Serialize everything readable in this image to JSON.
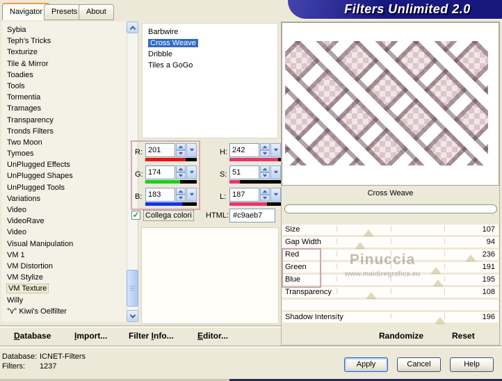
{
  "window": {
    "title": "Filters Unlimited 2.0"
  },
  "tabs": [
    {
      "label": "Navigator",
      "active": true
    },
    {
      "label": "Presets",
      "active": false
    },
    {
      "label": "About",
      "active": false
    }
  ],
  "category_list": {
    "selected": "VM Texture",
    "items": [
      "Sybia",
      "Teph's Tricks",
      "Texturize",
      "Tile & Mirror",
      "Toadies",
      "Tools",
      "Tormentia",
      "Tramages",
      "Transparency",
      "Tronds Filters",
      "Two Moon",
      "Tymoes",
      "UnPlugged Effects",
      "UnPlugged Shapes",
      "UnPlugged Tools",
      "Variations",
      "Video",
      "VideoRave",
      "Video",
      "Visual Manipulation",
      "VM 1",
      "VM Distortion",
      "VM Stylize",
      "VM Texture",
      "Willy",
      "°v° Kiwi's Oelfilter"
    ]
  },
  "filter_list": {
    "selected": "Cross Weave",
    "items": [
      "Barbwire",
      "Cross Weave",
      "Dribble",
      "Tiles a GoGo"
    ]
  },
  "color_controls": {
    "rgb": [
      {
        "label": "R:",
        "value": "201",
        "pct": 79,
        "bar_color": "#ee1111"
      },
      {
        "label": "G:",
        "value": "174",
        "pct": 68,
        "bar_color": "#1ad01a"
      },
      {
        "label": "B:",
        "value": "183",
        "pct": 72,
        "bar_color": "#1133ee"
      }
    ],
    "hsl": [
      {
        "label": "H:",
        "value": "242",
        "pct": 95,
        "bar_color": "#e8356d"
      },
      {
        "label": "S:",
        "value": "51",
        "pct": 20,
        "bar_color": "#e8356d"
      },
      {
        "label": "L:",
        "value": "187",
        "pct": 73,
        "bar_color": "#e8356d"
      }
    ],
    "link_checkbox": {
      "checked": true,
      "glyph": "✓",
      "label": "Collega colori"
    },
    "html_label": "HTML:",
    "html_value": "#c9aeb7"
  },
  "preview": {
    "caption": "Cross Weave"
  },
  "sliders": [
    {
      "label": "Size",
      "value": "107",
      "pct": 40
    },
    {
      "label": "Gap Width",
      "value": "94",
      "pct": 36
    },
    {
      "label": "Red",
      "value": "236",
      "pct": 87
    },
    {
      "label": "Green",
      "value": "191",
      "pct": 71
    },
    {
      "label": "Blue",
      "value": "195",
      "pct": 72
    },
    {
      "label": "Transparency",
      "value": "108",
      "pct": 41
    },
    {
      "label": "",
      "value": "",
      "pct": 0
    },
    {
      "label": "Shadow Intensity",
      "value": "196",
      "pct": 73
    }
  ],
  "watermark": {
    "line1": "Pinuccia",
    "line2": "www.maidiregrafica.eu"
  },
  "panel_buttons": {
    "randomize": "Randomize",
    "reset": "Reset"
  },
  "menu": {
    "items": [
      {
        "pre": "",
        "u": "D",
        "post": "atabase"
      },
      {
        "pre": "",
        "u": "I",
        "post": "mport..."
      },
      {
        "pre": "Filter ",
        "u": "I",
        "post": "nfo..."
      },
      {
        "pre": "",
        "u": "E",
        "post": "ditor..."
      }
    ]
  },
  "status": {
    "db_label": "Database:",
    "db_value": "ICNET-Filters",
    "filters_label": "Filters:",
    "filters_value": "1237"
  },
  "dialog_buttons": {
    "apply": "Apply",
    "cancel": "Cancel",
    "help": "Help"
  },
  "colors": {
    "selection": "#316ac5",
    "banner": "#17177d",
    "annotation": "#d0a4ae"
  }
}
